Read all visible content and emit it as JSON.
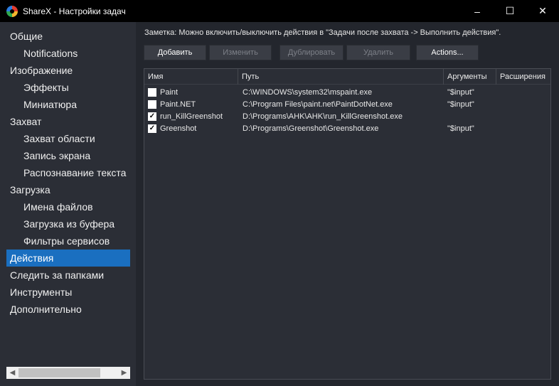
{
  "window": {
    "title": "ShareX - Настройки задач",
    "minimize": "–",
    "maximize": "☐",
    "close": "✕"
  },
  "sidebar": {
    "items": [
      {
        "label": "Общие",
        "level": 0
      },
      {
        "label": "Notifications",
        "level": 1
      },
      {
        "label": "Изображение",
        "level": 0
      },
      {
        "label": "Эффекты",
        "level": 1
      },
      {
        "label": "Миниатюра",
        "level": 1
      },
      {
        "label": "Захват",
        "level": 0
      },
      {
        "label": "Захват области",
        "level": 1
      },
      {
        "label": "Запись экрана",
        "level": 1
      },
      {
        "label": "Распознавание текста",
        "level": 1
      },
      {
        "label": "Загрузка",
        "level": 0
      },
      {
        "label": "Имена файлов",
        "level": 1
      },
      {
        "label": "Загрузка из буфера",
        "level": 1
      },
      {
        "label": "Фильтры сервисов",
        "level": 1
      },
      {
        "label": "Действия",
        "level": 0,
        "selected": true
      },
      {
        "label": "Следить за папками",
        "level": 0
      },
      {
        "label": "Инструменты",
        "level": 0
      },
      {
        "label": "Дополнительно",
        "level": 0
      }
    ],
    "scroll_left": "◀",
    "scroll_right": "▶"
  },
  "main": {
    "note": "Заметка: Можно включить/выключить действия в \"Задачи после захвата -> Выполнить действия\".",
    "buttons": {
      "add": "Добавить",
      "edit": "Изменить",
      "duplicate": "Дублировать",
      "delete": "Удалить",
      "actions": "Actions..."
    },
    "columns": {
      "name": "Имя",
      "path": "Путь",
      "args": "Аргументы",
      "ext": "Расширения"
    },
    "rows": [
      {
        "checked": false,
        "name": "Paint",
        "path": "C:\\WINDOWS\\system32\\mspaint.exe",
        "args": "\"$input\"",
        "ext": ""
      },
      {
        "checked": false,
        "name": "Paint.NET",
        "path": "C:\\Program Files\\paint.net\\PaintDotNet.exe",
        "args": "\"$input\"",
        "ext": ""
      },
      {
        "checked": true,
        "name": "run_KillGreenshot",
        "path": "D:\\Programs\\AHK\\AHK\\run_KillGreenshot.exe",
        "args": "",
        "ext": ""
      },
      {
        "checked": true,
        "name": "Greenshot",
        "path": "D:\\Programs\\Greenshot\\Greenshot.exe",
        "args": "\"$input\"",
        "ext": ""
      }
    ],
    "check_mark": "✓"
  }
}
